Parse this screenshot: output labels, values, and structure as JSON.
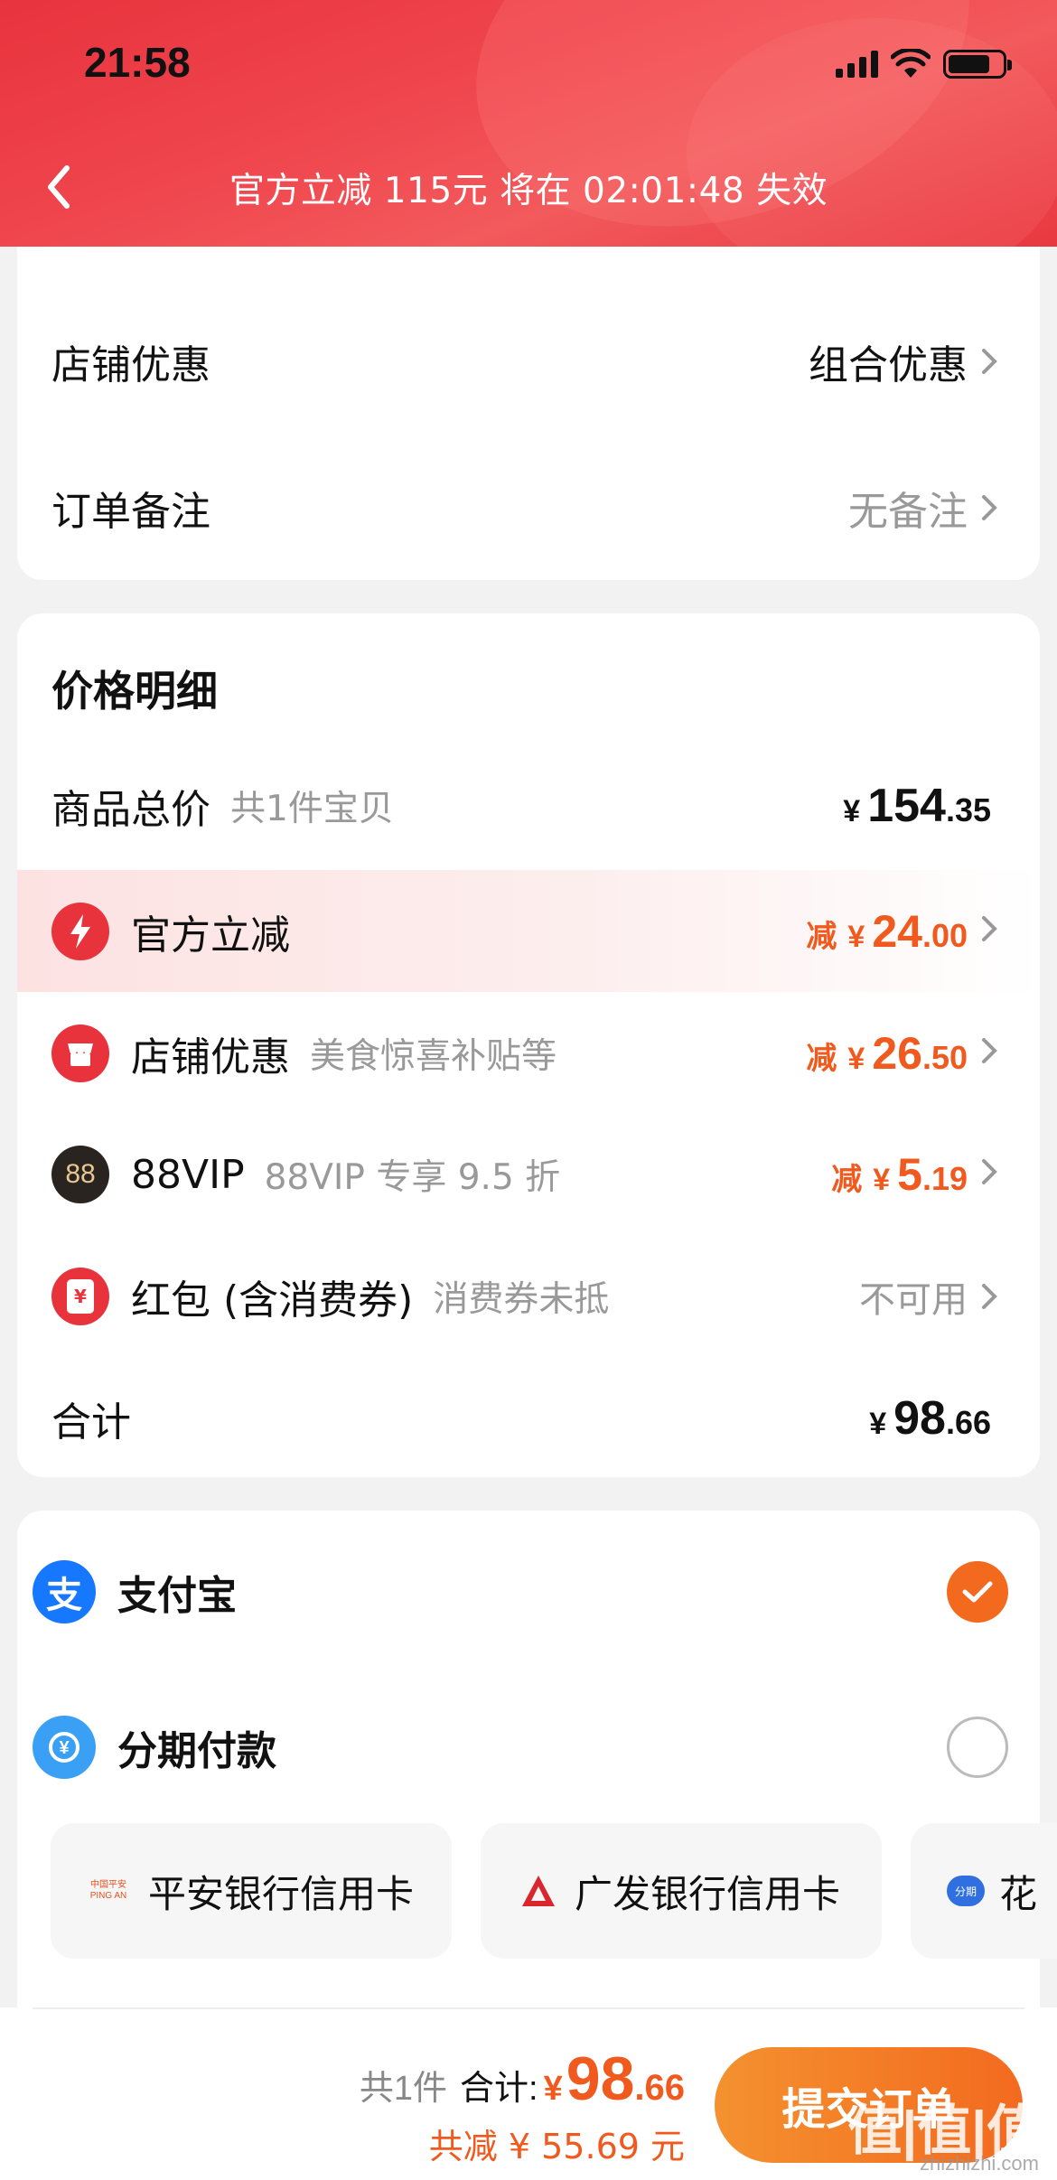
{
  "status_bar": {
    "time": "21:58"
  },
  "header": {
    "countdown": "官方立减 115元 将在 02:01:48 失效"
  },
  "shop_section": {
    "shop_discount_label": "店铺优惠",
    "shop_discount_value": "组合优惠",
    "order_note_label": "订单备注",
    "order_note_value": "无备注"
  },
  "price_detail": {
    "title": "价格明细",
    "goods_total": {
      "label": "商品总价",
      "sub": "共1件宝贝",
      "currency": "¥",
      "int": "154",
      "dec": ".35"
    },
    "official": {
      "label": "官方立减",
      "prefix": "减",
      "currency": "¥",
      "int": "24",
      "dec": ".00"
    },
    "shop": {
      "label": "店铺优惠",
      "sub": "美食惊喜补贴等",
      "prefix": "减",
      "currency": "¥",
      "int": "26",
      "dec": ".50"
    },
    "vip": {
      "icon_text": "88",
      "label": "88VIP",
      "sub": "88VIP 专享 9.5 折",
      "prefix": "减",
      "currency": "¥",
      "int": "5",
      "dec": ".19"
    },
    "redpacket": {
      "icon_text": "¥",
      "label": "红包 (含消费券)",
      "sub": "消费券未抵",
      "value": "不可用"
    },
    "total": {
      "label": "合计",
      "currency": "¥",
      "int": "98",
      "dec": ".66"
    }
  },
  "payment": {
    "alipay_label": "支付宝",
    "alipay_icon": "支",
    "installment_label": "分期付款",
    "banks": [
      {
        "name": "平安银行信用卡",
        "logo": "中国平安 PING AN"
      },
      {
        "name": "广发银行信用卡"
      },
      {
        "name": "花",
        "logo": "分期"
      }
    ]
  },
  "footer": {
    "count": "共1件",
    "total_label": "合计:",
    "currency": "¥",
    "int": "98",
    "dec": ".66",
    "saved": "共减 ¥ 55.69 元",
    "submit": "提交订单"
  },
  "watermark": {
    "main": "值|值|值",
    "sub": "zhizhizhi.com"
  },
  "colors": {
    "header_red": "#e8333d",
    "accent_orange": "#f05a1e",
    "submit_orange": "#f36a1f"
  }
}
